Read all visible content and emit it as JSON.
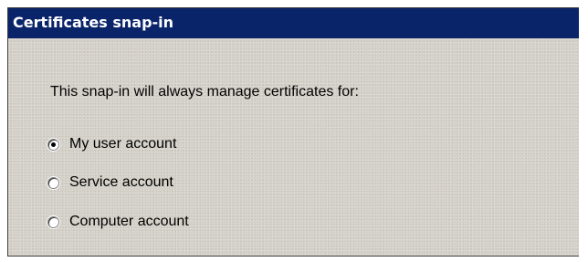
{
  "window": {
    "title": "Certificates snap-in"
  },
  "main": {
    "prompt": "This snap-in will always manage certificates for:",
    "options": [
      {
        "label": "My user account",
        "selected": true
      },
      {
        "label": "Service account",
        "selected": false
      },
      {
        "label": "Computer account",
        "selected": false
      }
    ]
  },
  "colors": {
    "titlebar": "#0a246a",
    "dialog_background": "#d4d0c8"
  }
}
